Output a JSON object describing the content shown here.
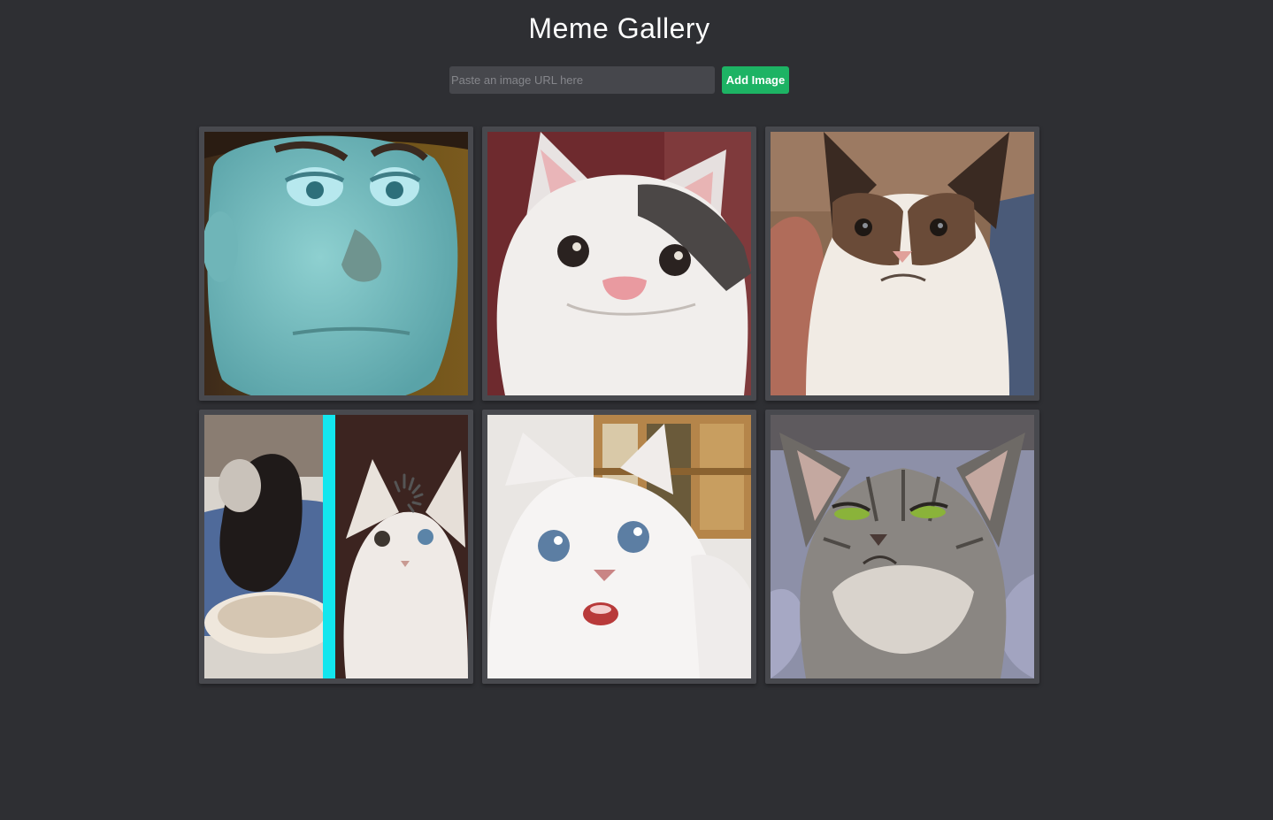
{
  "header": {
    "title": "Meme Gallery"
  },
  "add_form": {
    "placeholder": "Paste an image URL here",
    "value": "",
    "button_label": "Add Image"
  },
  "colors": {
    "background": "#2e2f33",
    "card": "#48494e",
    "accent": "#1db364"
  },
  "gallery": {
    "images": [
      {
        "name": "woody-face-meme"
      },
      {
        "name": "beluga-cat-meme"
      },
      {
        "name": "grumpy-cat-meme"
      },
      {
        "name": "loading-kitten-meme"
      },
      {
        "name": "shocked-white-cat-meme"
      },
      {
        "name": "angry-grey-kitten-meme"
      }
    ]
  }
}
